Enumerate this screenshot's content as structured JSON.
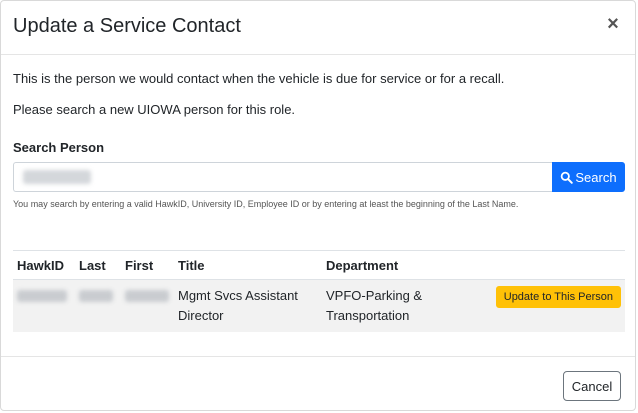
{
  "dialog": {
    "title": "Update a Service Contact",
    "close_symbol": "×"
  },
  "body": {
    "intro_text": "This is the person we would contact when the vehicle is due for service or for a recall.",
    "instruction_text": "Please search a new UIOWA person for this role."
  },
  "search": {
    "label": "Search Person",
    "button_label": "Search",
    "button_icon": "search-icon",
    "help_text": "You may search by entering a valid HawkID, University ID, Employee ID or by entering at least the beginning of the Last Name."
  },
  "results": {
    "columns": [
      "HawkID",
      "Last",
      "First",
      "Title",
      "Department"
    ],
    "rows": [
      {
        "title": "Mgmt Svcs Assistant Director",
        "department": "VPFO-Parking & Transportation",
        "action_label": "Update to This Person"
      }
    ]
  },
  "footer": {
    "cancel_label": "Cancel"
  },
  "colors": {
    "primary": "#0d6efd",
    "warning": "#ffc107"
  }
}
